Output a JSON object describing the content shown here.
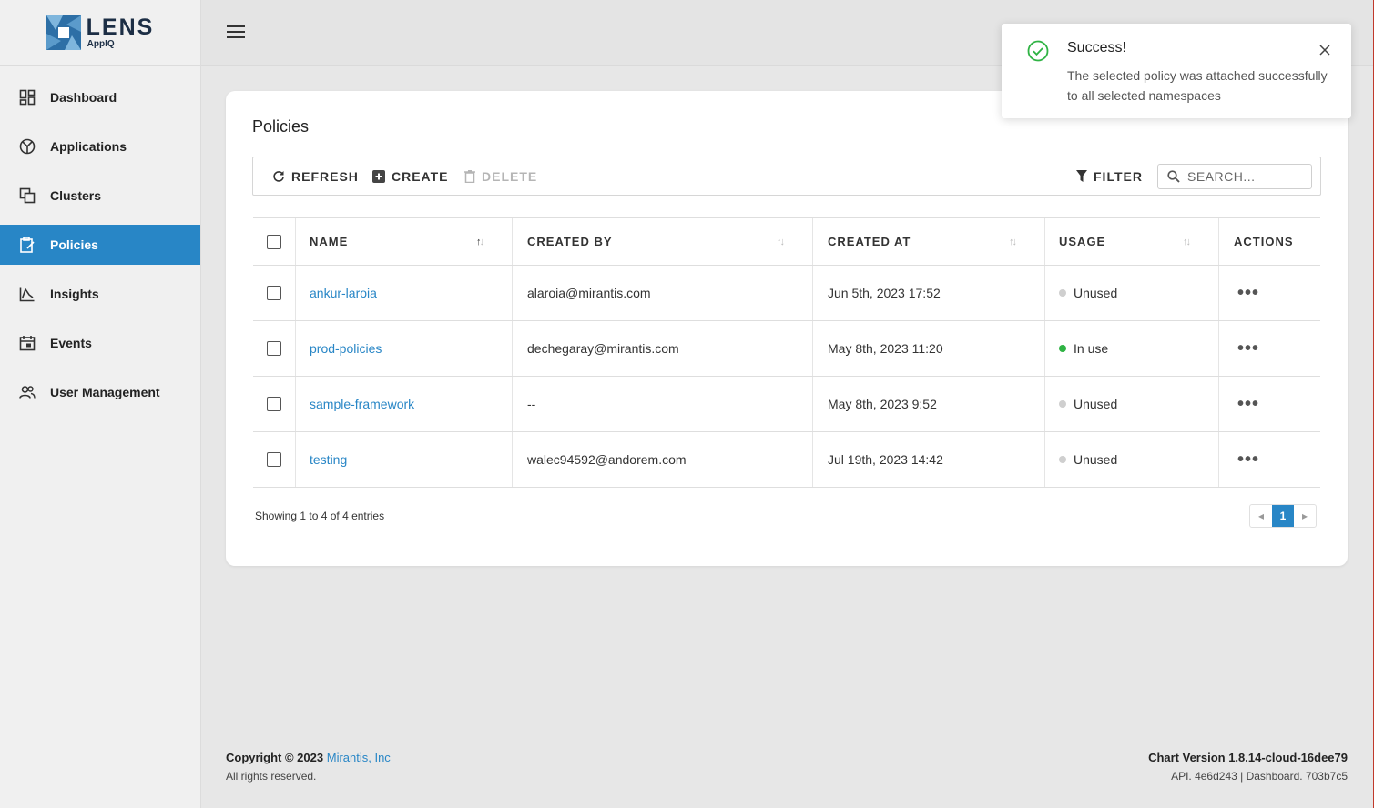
{
  "brand": {
    "name": "LENS",
    "sub": "AppIQ"
  },
  "nav": [
    {
      "label": "Dashboard",
      "icon": "dashboard-icon"
    },
    {
      "label": "Applications",
      "icon": "applications-icon"
    },
    {
      "label": "Clusters",
      "icon": "clusters-icon"
    },
    {
      "label": "Policies",
      "icon": "policies-icon",
      "active": true
    },
    {
      "label": "Insights",
      "icon": "insights-icon"
    },
    {
      "label": "Events",
      "icon": "events-icon"
    },
    {
      "label": "User Management",
      "icon": "users-icon"
    }
  ],
  "page": {
    "title": "Policies"
  },
  "toolbar": {
    "refresh": "REFRESH",
    "create": "CREATE",
    "delete": "DELETE",
    "filter": "FILTER",
    "search_placeholder": "SEARCH..."
  },
  "table": {
    "headers": {
      "name": "NAME",
      "created_by": "CREATED BY",
      "created_at": "CREATED AT",
      "usage": "USAGE",
      "actions": "ACTIONS"
    },
    "rows": [
      {
        "name": "ankur-laroia",
        "created_by": "alaroia@mirantis.com",
        "created_at": "Jun 5th, 2023 17:52",
        "usage": "Unused"
      },
      {
        "name": "prod-policies",
        "created_by": "dechegaray@mirantis.com",
        "created_at": "May 8th, 2023 11:20",
        "usage": "In use"
      },
      {
        "name": "sample-framework",
        "created_by": "--",
        "created_at": "May 8th, 2023 9:52",
        "usage": "Unused"
      },
      {
        "name": "testing",
        "created_by": "walec94592@andorem.com",
        "created_at": "Jul 19th, 2023 14:42",
        "usage": "Unused"
      }
    ],
    "showing": "Showing 1 to 4 of 4 entries",
    "current_page": "1"
  },
  "toast": {
    "title": "Success!",
    "message": "The selected policy was attached successfully to all selected namespaces"
  },
  "footer": {
    "copyright": "Copyright © 2023",
    "company": "Mirantis, Inc",
    "rights": "All rights reserved.",
    "chart_version": "Chart Version 1.8.14-cloud-16dee79",
    "api": "API. 4e6d243 | Dashboard. 703b7c5"
  },
  "colors": {
    "accent": "#2886c6",
    "in_use": "#2fb344",
    "unused": "#cfcfcf",
    "success": "#2fb344"
  }
}
